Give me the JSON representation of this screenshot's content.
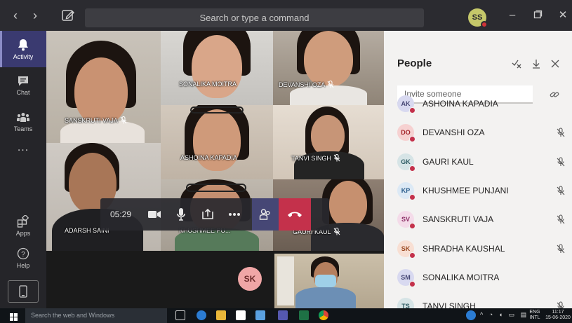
{
  "titlebar": {
    "search_placeholder": "Search or type a command",
    "user_initials": "SS"
  },
  "rail": {
    "items": [
      {
        "label": "Activity",
        "icon": "bell-icon",
        "active": true
      },
      {
        "label": "Chat",
        "icon": "chat-icon"
      },
      {
        "label": "Teams",
        "icon": "teams-icon"
      },
      {
        "label": "Apps",
        "icon": "apps-icon"
      },
      {
        "label": "Help",
        "icon": "help-icon"
      }
    ],
    "more": "..."
  },
  "stage": {
    "tiles": [
      {
        "name": "SANSKRUTI VAJA",
        "muted": true
      },
      {
        "name": "SONALIKA MOITRA",
        "muted": false
      },
      {
        "name": "DEVANSHI OZA",
        "muted": true
      },
      {
        "name": "ASHOINA KAPADIA",
        "muted": false
      },
      {
        "name": "TANVI SINGH",
        "muted": true
      },
      {
        "name": "ADARSH SAINI",
        "muted": false
      },
      {
        "name": "KHUSHMEE PU...",
        "muted": false
      },
      {
        "name": "GAURI KAUL",
        "muted": true
      }
    ],
    "self_initials": "SK"
  },
  "toolbar": {
    "timer": "05:29"
  },
  "people": {
    "title": "People",
    "invite_placeholder": "Invite someone",
    "members": [
      {
        "initials": "AK",
        "name": "ASHOINA KAPADIA",
        "bg": "#d8d9f0",
        "fg": "#464775",
        "muted": false
      },
      {
        "initials": "DO",
        "name": "DEVANSHI OZA",
        "bg": "#f6d1d1",
        "fg": "#a4262c",
        "muted": true
      },
      {
        "initials": "GK",
        "name": "GAURI KAUL",
        "bg": "#d6e4e6",
        "fg": "#2f5d64",
        "muted": true
      },
      {
        "initials": "KP",
        "name": "KHUSHMEE PUNJANI",
        "bg": "#dce9f5",
        "fg": "#2b5d8c",
        "muted": true
      },
      {
        "initials": "SV",
        "name": "SANSKRUTI VAJA",
        "bg": "#f4dbe9",
        "fg": "#8c2f66",
        "muted": true
      },
      {
        "initials": "SK",
        "name": "SHRADHA KAUSHAL",
        "bg": "#f8dfd3",
        "fg": "#9c4a22",
        "muted": true
      },
      {
        "initials": "SM",
        "name": "SONALIKA MOITRA",
        "bg": "#d8d9f0",
        "fg": "#464775",
        "muted": false
      },
      {
        "initials": "TS",
        "name": "TANVI SINGH",
        "bg": "#d6e4e6",
        "fg": "#2f5d64",
        "muted": true
      }
    ]
  },
  "taskbar": {
    "search_placeholder": "Search the web and Windows",
    "lang_top": "ENG",
    "lang_bottom": "INTL",
    "time": "11:17",
    "date": "15-06-2020"
  },
  "colors": {
    "accent": "#464775",
    "hangup": "#c4314b",
    "rail_active": "#3a3a70"
  }
}
